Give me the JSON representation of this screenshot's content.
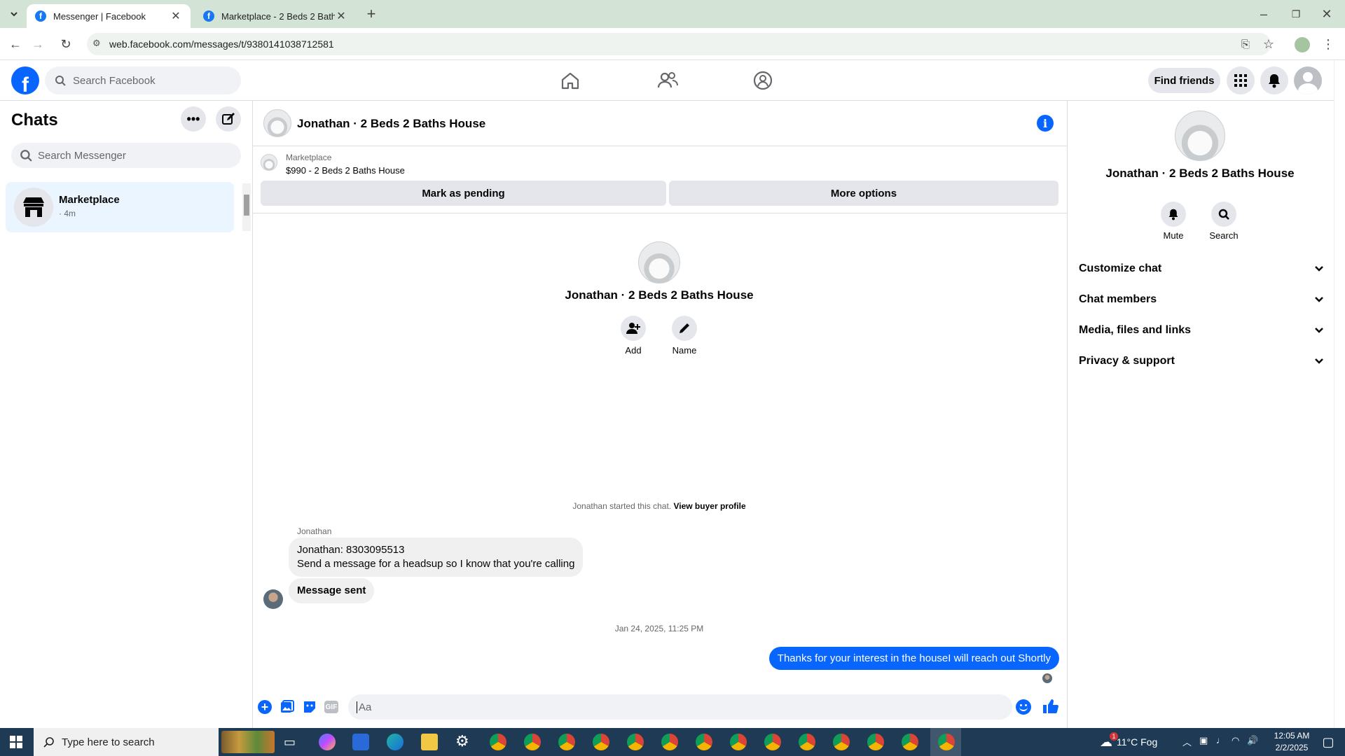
{
  "browser": {
    "tabs": [
      {
        "title": "Messenger | Facebook",
        "active": true
      },
      {
        "title": "Marketplace - 2 Beds 2 Baths H",
        "active": false
      }
    ],
    "url": "web.facebook.com/messages/t/9380141038712581"
  },
  "fb_header": {
    "logo": "f",
    "search_placeholder": "Search Facebook",
    "find_friends": "Find friends",
    "nav_icons": [
      "home-icon",
      "friends-icon",
      "groups-icon"
    ]
  },
  "sidebar": {
    "title": "Chats",
    "search_placeholder": "Search Messenger",
    "chats": [
      {
        "name": "Marketplace",
        "time": "· 4m"
      }
    ]
  },
  "conversation": {
    "title": "Jonathan · 2 Beds 2 Baths House",
    "listing": {
      "source": "Marketplace",
      "summary": "$990 - 2 Beds 2 Baths House"
    },
    "actions": {
      "mark_pending": "Mark as pending",
      "more_options": "More options"
    },
    "profile": {
      "name": "Jonathan · 2 Beds 2 Baths House",
      "add_label": "Add",
      "name_label": "Name"
    },
    "started_text": "Jonathan started this chat.",
    "view_buyer": "View buyer profile",
    "sender_name": "Jonathan",
    "messages_in": {
      "line1": "Jonathan: 8303095513",
      "line2": "Send a message for a headsup so I know that you're calling",
      "status": "Message sent"
    },
    "timestamp": "Jan 24, 2025, 11:25 PM",
    "message_out": "Thanks for your interest in the houseI will reach out Shortly",
    "composer_placeholder": "Aa"
  },
  "details": {
    "name": "Jonathan · 2 Beds 2 Baths House",
    "mute": "Mute",
    "search": "Search",
    "sections": [
      "Customize chat",
      "Chat members",
      "Media, files and links",
      "Privacy & support"
    ]
  },
  "taskbar": {
    "search_placeholder": "Type here to search",
    "weather": "11°C  Fog",
    "time": "12:05 AM",
    "date": "2/2/2025",
    "weather_badge": "1"
  },
  "colors": {
    "accent": "#0866ff",
    "selected": "#ebf5ff",
    "chrome": "#d3e3d6"
  }
}
